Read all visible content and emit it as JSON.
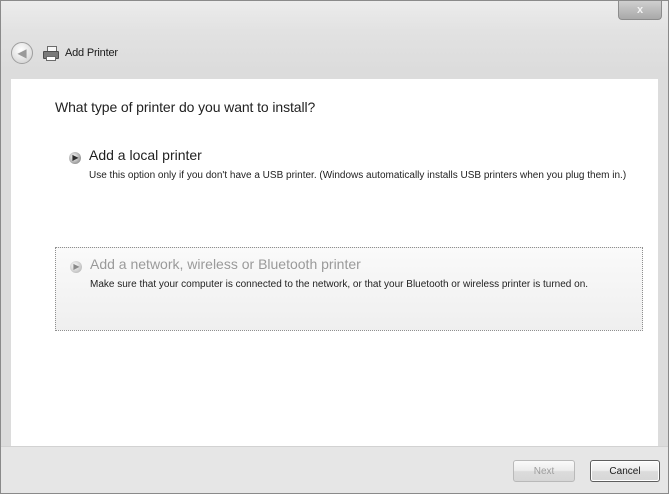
{
  "window": {
    "title": "Add Printer",
    "close_glyph": "x"
  },
  "nav": {
    "back_glyph": "◀",
    "title_icon": "printer-icon"
  },
  "main": {
    "question": "What type of printer do you want to install?",
    "options": [
      {
        "title": "Add a local printer",
        "description": "Use this option only if you don't have a USB printer. (Windows automatically installs USB printers when you plug them in.)"
      },
      {
        "title": "Add a network, wireless or Bluetooth printer",
        "description": "Make sure that your computer is connected to the network, or that your Bluetooth or wireless printer is turned on."
      }
    ]
  },
  "footer": {
    "next_label": "Next",
    "cancel_label": "Cancel"
  }
}
